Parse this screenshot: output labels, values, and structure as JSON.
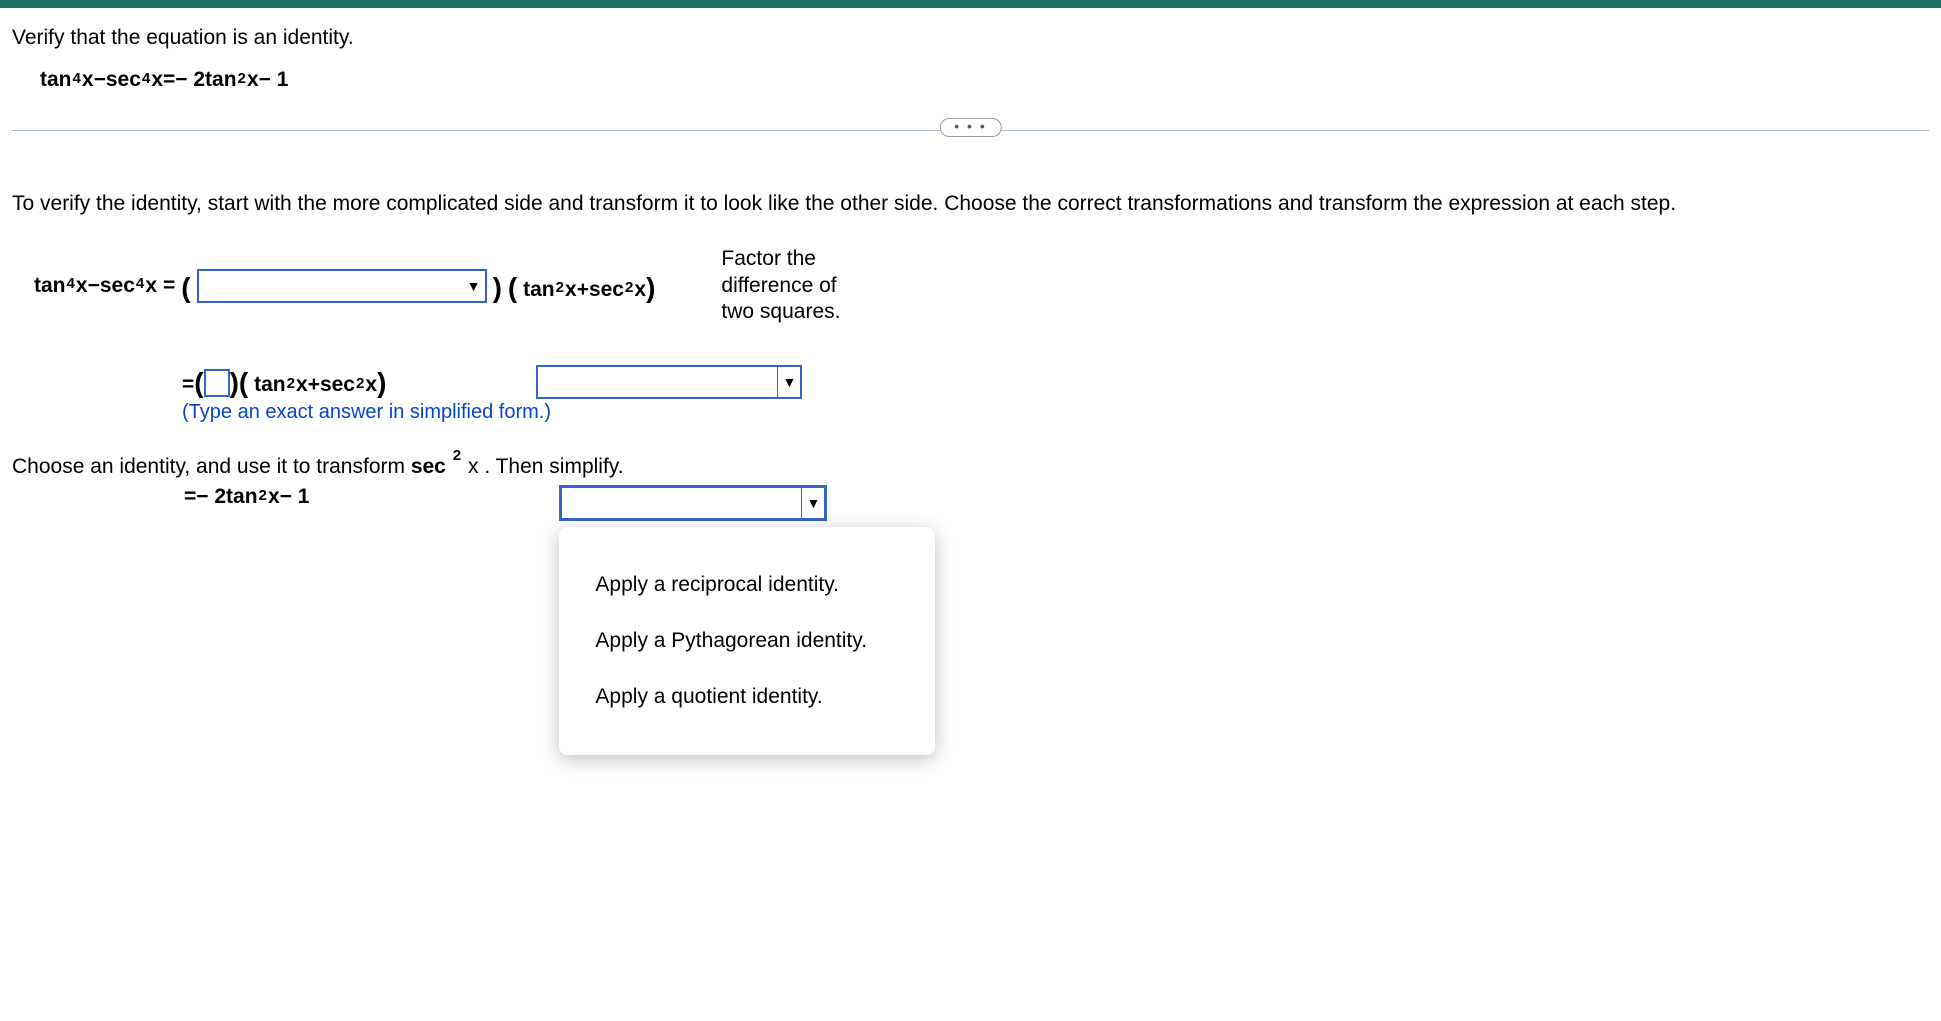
{
  "header": {
    "instruction": "Verify that the equation is an identity."
  },
  "equation": {
    "lhs_fn1": "tan",
    "lhs_exp1": "4",
    "lhs_var1": "x",
    "minus1": " − ",
    "lhs_fn2": "sec",
    "lhs_exp2": "4",
    "lhs_var2": "x",
    "eq": " = ",
    "rhs_coef": "− 2 ",
    "rhs_fn": "tan",
    "rhs_exp": "2",
    "rhs_var": "x",
    "rhs_tail": " − 1"
  },
  "separator": {
    "dots": "• • •"
  },
  "body": {
    "intro": "To verify the identity, start with the more complicated side and transform it to look like the other side. Choose the correct transformations and transform the expression at each step."
  },
  "step1": {
    "left_fn1": "tan",
    "left_exp1": "4",
    "left_var1": "x",
    "minus": " − ",
    "left_fn2": "sec",
    "left_exp2": "4",
    "left_var2": "x",
    "eq": " = ",
    "open1": "(",
    "close_paren": ")",
    "f2_open": "(",
    "f2_fn1": "tan",
    "f2_exp1": "2",
    "f2_var1": "x",
    "f2_plus": " + ",
    "f2_fn2": "sec",
    "f2_exp2": "2",
    "f2_var2": "x",
    "f2_close": ")",
    "reason_l1": "Factor the",
    "reason_l2": "difference of",
    "reason_l3": "two squares."
  },
  "step2": {
    "eq": "= ",
    "open1": "(",
    "close1": ")",
    "f_open": "(",
    "f_fn1": "tan",
    "f_exp1": "2",
    "f_var1": "x",
    "f_plus": " + ",
    "f_fn2": "sec",
    "f_exp2": "2",
    "f_var2": "x",
    "f_close": ")",
    "hint": "(Type an exact answer in simplified form.)"
  },
  "step3": {
    "prefix": "Choose an identity, and use it to transform ",
    "fn": "sec",
    "exp": "2",
    "var": "x",
    "suffix": ". Then simplify."
  },
  "final": {
    "eq": "= ",
    "coef": "− 2 ",
    "fn": "tan",
    "exp": "2",
    "varr": "x",
    "tail": " − 1"
  },
  "dropdown": {
    "opt1": "Apply a reciprocal identity.",
    "opt2": "Apply a Pythagorean identity.",
    "opt3": "Apply a quotient identity."
  }
}
